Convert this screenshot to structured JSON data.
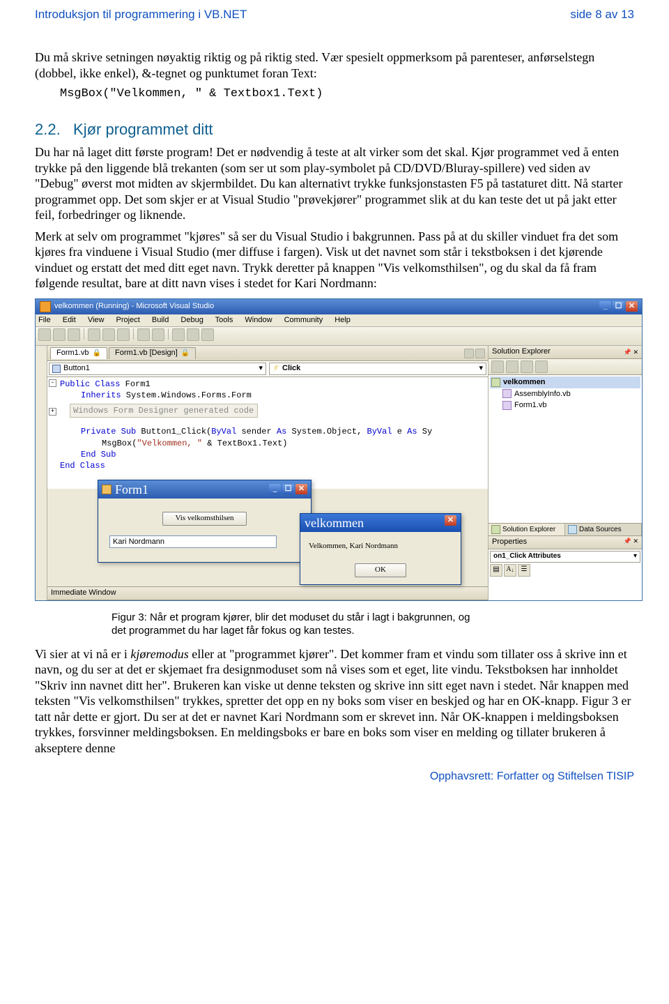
{
  "page": {
    "doc_title": "Introduksjon til programmering i VB.NET",
    "page_label": "side 8 av 13",
    "copyright": "Opphavsrett: Forfatter og Stiftelsen TISIP"
  },
  "text": {
    "p1": "Du må skrive setningen nøyaktig riktig og på riktig sted. Vær spesielt oppmerksom på parenteser, anførselstegn (dobbel, ikke enkel), &-tegnet og  punktumet foran Text:",
    "code1": "MsgBox(\"Velkommen, \" & Textbox1.Text)",
    "h22_num": "2.2.",
    "h22": "Kjør programmet ditt",
    "p2": "Du har nå laget ditt første program! Det er nødvendig å teste at alt virker som det skal. Kjør programmet ved å enten trykke på den liggende blå trekanten (som ser ut som play-symbolet på CD/DVD/Bluray-spillere) ved siden av \"Debug\" øverst mot midten av skjermbildet. Du kan alternativt trykke funksjonstasten F5 på tastaturet ditt. Nå starter programmet opp. Det som skjer er at Visual Studio \"prøvekjører\" programmet slik at du kan teste det ut på jakt etter feil, forbedringer og liknende.",
    "p3": "Merk at selv om programmet \"kjøres\" så ser du Visual Studio i bakgrunnen. Pass på at du skiller vinduet fra det som kjøres fra vinduene i Visual Studio (mer diffuse i fargen). Visk ut det navnet som står i tekstboksen i det kjørende vinduet og erstatt det med ditt eget navn. Trykk deretter på knappen \"Vis velkomsthilsen\", og du skal da få fram følgende resultat, bare at ditt navn vises i stedet for Kari Nordmann:",
    "figcap": "Figur 3: Når et program kjører, blir det moduset du står i lagt i bakgrunnen, og det programmet du har laget får fokus og kan testes.",
    "p4a": "Vi sier at vi nå er i ",
    "p4_em": "kjøremodus",
    "p4b": " eller at \"programmet kjører\". Det kommer fram et vindu som tillater oss å skrive inn et navn, og du ser at det er skjemaet fra designmoduset som nå vises som et eget, lite vindu. Tekstboksen har innholdet \"Skriv inn navnet ditt her\". Brukeren kan viske ut denne teksten og skrive inn sitt eget navn i stedet. Når knappen med teksten \"Vis velkomsthilsen\" trykkes, spretter det opp en ny boks som viser en beskjed og har en OK-knapp. Figur 3 er tatt når dette er gjort. Du ser at det er navnet Kari Nordmann som er skrevet inn. Når OK-knappen i meldingsboksen trykkes, forsvinner meldingsboksen. En meldingsboks er bare en boks som viser en melding og tillater brukeren å akseptere denne"
  },
  "vs": {
    "title": "velkommen (Running) - Microsoft Visual Studio",
    "menu": [
      "File",
      "Edit",
      "View",
      "Project",
      "Build",
      "Debug",
      "Tools",
      "Window",
      "Community",
      "Help"
    ],
    "tabs": {
      "active": "Form1.vb",
      "inactive": "Form1.vb [Design]"
    },
    "combo_left": "Button1",
    "combo_right": "Click",
    "code": {
      "l1a": "Public",
      "l1b": " Class",
      "l1c": " Form1",
      "l2a": "Inherits",
      "l2b": " System.Windows.Forms.Form",
      "designer": "Windows Form Designer generated code",
      "l3a": "Private",
      "l3b": " Sub",
      "l3c": " Button1_Click(",
      "l3d": "ByVal",
      "l3e": " sender ",
      "l3f": "As",
      "l3g": " System.Object, ",
      "l3h": "ByVal",
      "l3i": " e ",
      "l3j": "As",
      "l3k": " Sy",
      "l4a": "MsgBox(",
      "l4b": "\"Velkommen, \"",
      "l4c": " & TextBox1.Text)",
      "l5": "End Sub",
      "l6": "End Class"
    },
    "form1": {
      "title": "Form1",
      "button": "Vis velkomsthilsen",
      "textbox": "Kari Nordmann"
    },
    "msgbox": {
      "title": "velkommen",
      "text": "Velkommen, Kari Nordmann",
      "ok": "OK"
    },
    "immediate": "Immediate Window",
    "solution_explorer": {
      "title": "Solution Explorer",
      "root": "velkommen",
      "items": [
        "AssemblyInfo.vb",
        "Form1.vb"
      ],
      "tab1": "Solution Explorer",
      "tab2": "Data Sources"
    },
    "properties": {
      "title": "Properties",
      "combo": "on1_Click Attributes"
    }
  }
}
